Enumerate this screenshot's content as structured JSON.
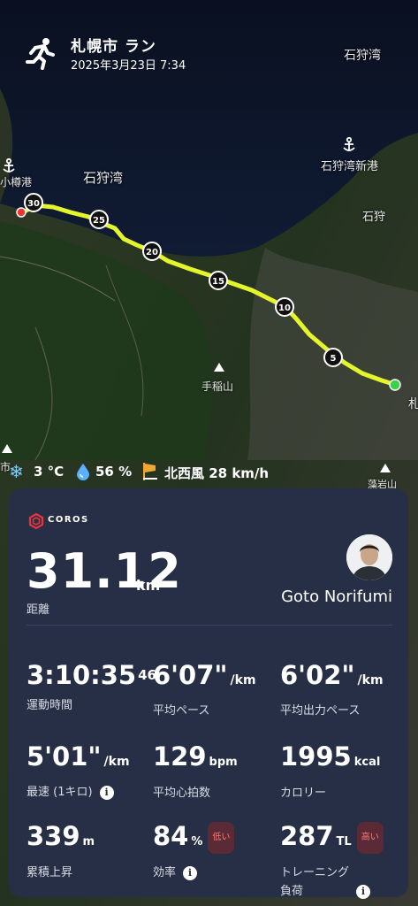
{
  "header": {
    "title": "札幌市 ラン",
    "datetime": "2025年3月23日 7:34"
  },
  "map": {
    "labels": {
      "bay_top_right": "石狩湾",
      "bay_center": "石狩湾",
      "port_left": "小樽港",
      "port_new": "石狩湾新港",
      "ishikari": "石狩",
      "mountain": "手稲山",
      "right_edge": "札",
      "left_city": "市",
      "bottom_right": "藻岩山"
    },
    "km_markers": [
      "30",
      "25",
      "20",
      "15",
      "10",
      "5"
    ],
    "route_color": "#e5f52c"
  },
  "weather": {
    "temperature": "3 °C",
    "humidity": "56 %",
    "wind": "北西風 28 km/h"
  },
  "card": {
    "brand": "COROS",
    "distance": {
      "value": "31.12",
      "unit": "km",
      "label": "距離"
    },
    "user_name": "Goto Norifumi",
    "stats": {
      "moving_time": {
        "value": "3:10:35",
        "sub": "46",
        "label": "運動時間"
      },
      "avg_pace": {
        "value": "6'07\"",
        "unit": "/km",
        "label": "平均ペース"
      },
      "avg_power_pace": {
        "value": "6'02\"",
        "unit": "/km",
        "label": "平均出力ペース"
      },
      "best_pace": {
        "value": "5'01\"",
        "unit": "/km",
        "label": "最速 (1キロ)"
      },
      "avg_hr": {
        "value": "129",
        "unit": "bpm",
        "label": "平均心拍数"
      },
      "calories": {
        "value": "1995",
        "unit": "kcal",
        "label": "カロリー"
      },
      "elevation": {
        "value": "339",
        "unit": "m",
        "label": "累積上昇"
      },
      "efficiency": {
        "value": "84",
        "unit": "%",
        "badge": "低い",
        "label": "効率"
      },
      "training_load": {
        "value": "287",
        "unit": "TL",
        "badge": "高い",
        "label_line1": "トレーニング",
        "label_line2": "負荷"
      }
    }
  }
}
